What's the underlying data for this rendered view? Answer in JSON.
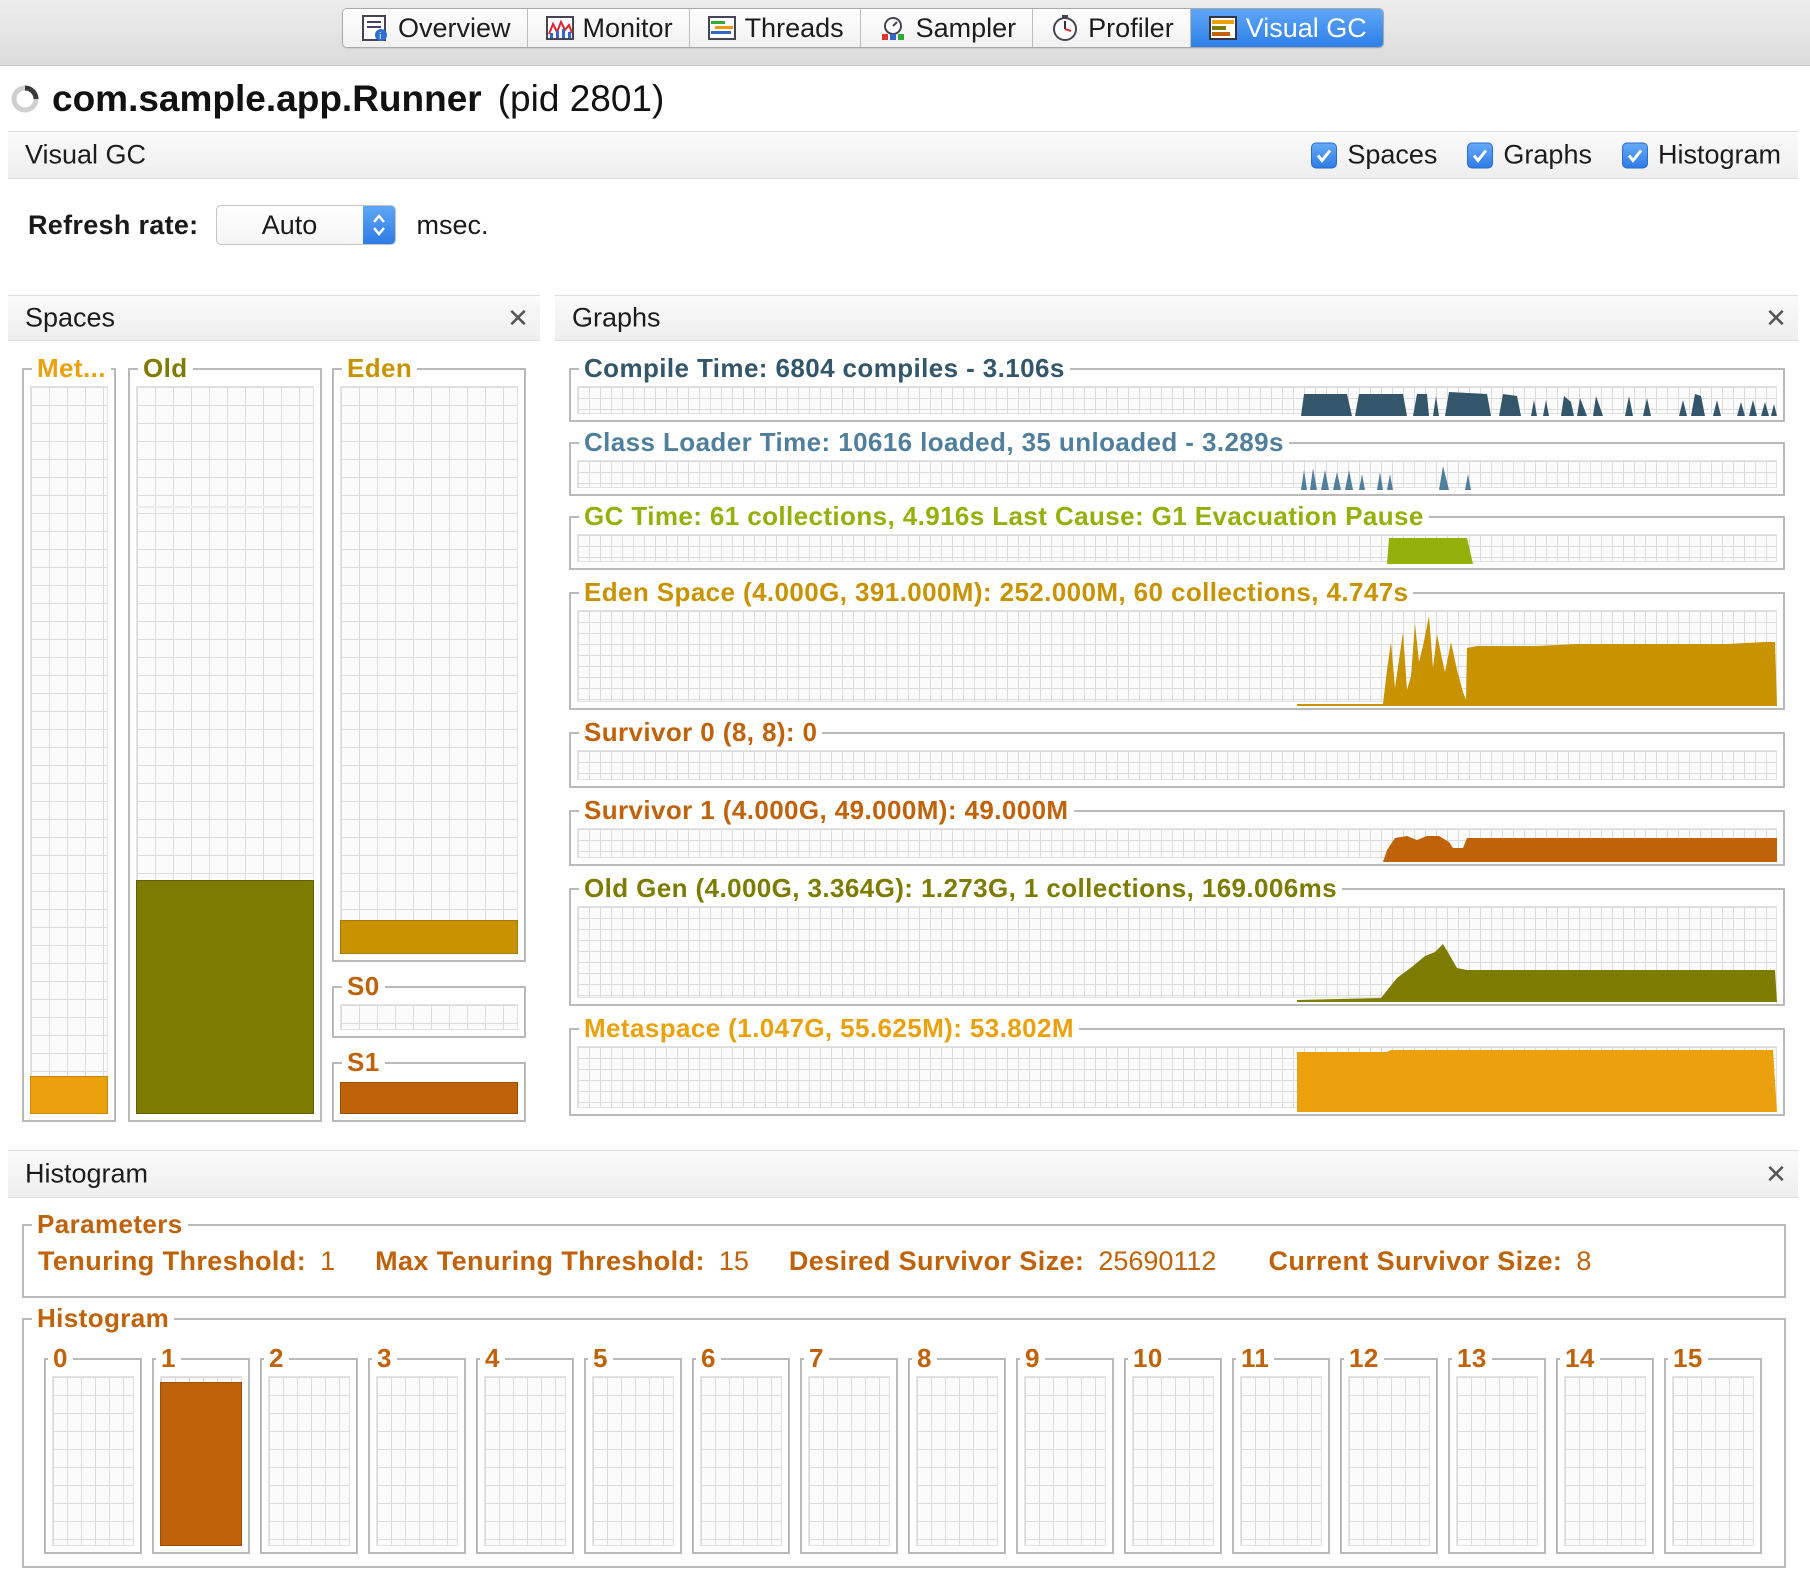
{
  "tabs": [
    {
      "label": "Overview",
      "icon": "overview-icon"
    },
    {
      "label": "Monitor",
      "icon": "monitor-icon"
    },
    {
      "label": "Threads",
      "icon": "threads-icon"
    },
    {
      "label": "Sampler",
      "icon": "sampler-icon"
    },
    {
      "label": "Profiler",
      "icon": "profiler-icon"
    },
    {
      "label": "Visual GC",
      "icon": "visual-gc-icon",
      "active": true
    }
  ],
  "app": {
    "name": "com.sample.app.Runner",
    "pid": "(pid 2801)"
  },
  "header": {
    "title": "Visual GC",
    "checkboxes": [
      {
        "label": "Spaces",
        "checked": true
      },
      {
        "label": "Graphs",
        "checked": true
      },
      {
        "label": "Histogram",
        "checked": true
      }
    ]
  },
  "refresh": {
    "label": "Refresh rate:",
    "value": "Auto",
    "unit": "msec."
  },
  "spaces": {
    "title": "Spaces",
    "close": "✕",
    "met": {
      "label": "Met...",
      "fill_fraction": 0.05
    },
    "old": {
      "label": "Old",
      "fill_fraction": 0.32
    },
    "eden": {
      "label": "Eden",
      "fill_fraction": 0.06
    },
    "s0": {
      "label": "S0",
      "fill_fraction": 0.0
    },
    "s1": {
      "label": "S1",
      "fill_fraction": 1.0
    }
  },
  "graphs": {
    "title": "Graphs",
    "close": "✕",
    "items": [
      {
        "key": "compile",
        "label": "Compile Time: 6804 compiles - 3.106s"
      },
      {
        "key": "classloader",
        "label": "Class Loader Time: 10616 loaded, 35 unloaded - 3.289s"
      },
      {
        "key": "gc",
        "label": "GC Time: 61 collections, 4.916s  Last Cause: G1 Evacuation Pause"
      },
      {
        "key": "eden",
        "label": "Eden Space (4.000G, 391.000M): 252.000M, 60 collections, 4.747s"
      },
      {
        "key": "s0",
        "label": "Survivor 0 (8, 8): 0"
      },
      {
        "key": "s1",
        "label": "Survivor 1 (4.000G, 49.000M): 49.000M"
      },
      {
        "key": "old",
        "label": "Old Gen (4.000G, 3.364G): 1.273G, 1 collections, 169.006ms"
      },
      {
        "key": "meta",
        "label": "Metaspace (1.047G, 55.625M): 53.802M"
      }
    ]
  },
  "histogram": {
    "title": "Histogram",
    "close": "✕",
    "parameters_title": "Parameters",
    "params": [
      {
        "label": "Tenuring Threshold:",
        "value": "1"
      },
      {
        "label": "Max Tenuring Threshold:",
        "value": "15"
      },
      {
        "label": "Desired Survivor Size:",
        "value": "25690112"
      },
      {
        "label": "Current Survivor Size:",
        "value": "8"
      }
    ],
    "histogram_title": "Histogram",
    "bins": [
      {
        "label": "0",
        "fill": 0
      },
      {
        "label": "1",
        "fill": 1
      },
      {
        "label": "2",
        "fill": 0
      },
      {
        "label": "3",
        "fill": 0
      },
      {
        "label": "4",
        "fill": 0
      },
      {
        "label": "5",
        "fill": 0
      },
      {
        "label": "6",
        "fill": 0
      },
      {
        "label": "7",
        "fill": 0
      },
      {
        "label": "8",
        "fill": 0
      },
      {
        "label": "9",
        "fill": 0
      },
      {
        "label": "10",
        "fill": 0
      },
      {
        "label": "11",
        "fill": 0
      },
      {
        "label": "12",
        "fill": 0
      },
      {
        "label": "13",
        "fill": 0
      },
      {
        "label": "14",
        "fill": 0
      },
      {
        "label": "15",
        "fill": 0
      }
    ]
  },
  "colors": {
    "accent_blue": "#2f7fe8",
    "compile": "#34566a",
    "classloader": "#4f7f9c",
    "gc": "#94b00a",
    "eden": "#c89200",
    "survivor": "#c0620a",
    "old": "#7e7c00",
    "metaspace": "#eba10d"
  }
}
